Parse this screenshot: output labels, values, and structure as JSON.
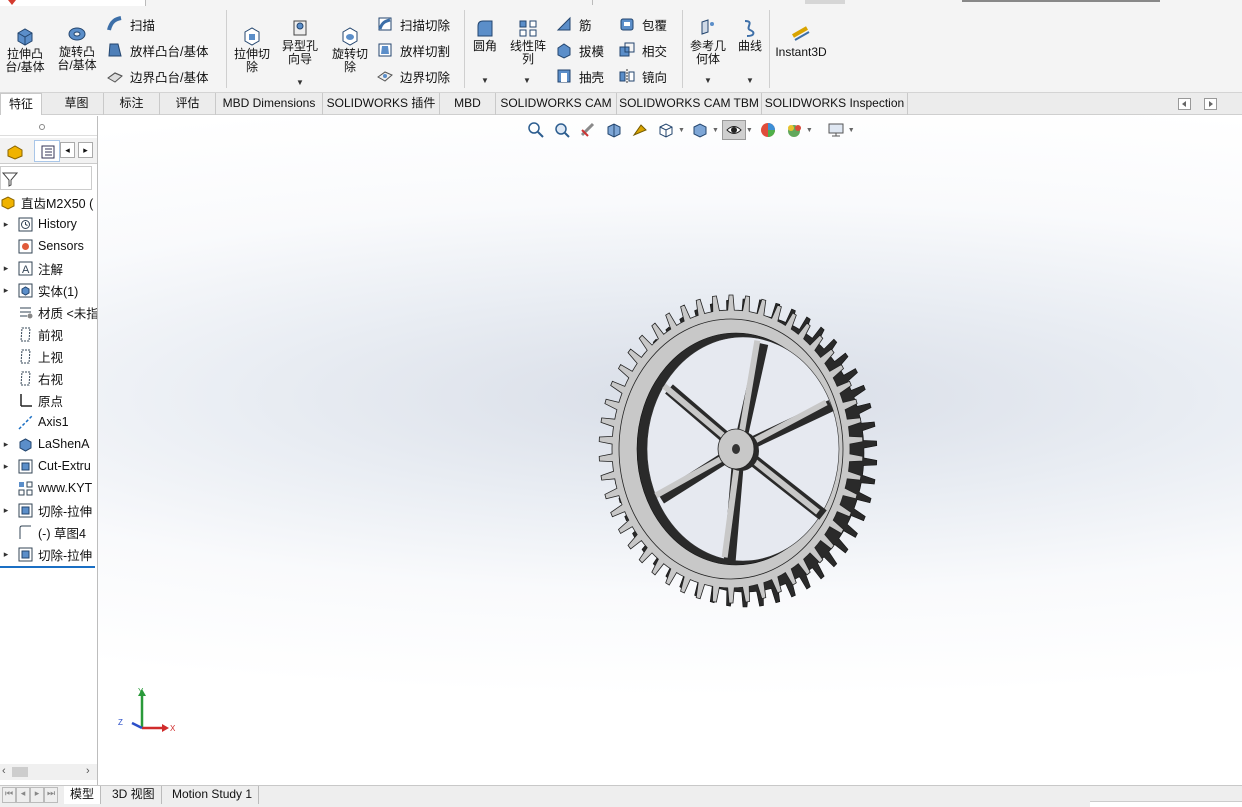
{
  "toolbar": {
    "extrude_boss": "拉伸凸\n台/基体",
    "revolve_boss": "旋转凸\n台/基体",
    "sweep": "扫描",
    "loft_boss": "放样凸台/基体",
    "boundary_boss": "边界凸台/基体",
    "extrude_cut": "拉伸切\n除",
    "hole_wizard": "异型孔\n向导",
    "revolve_cut": "旋转切\n除",
    "swept_cut": "扫描切除",
    "lofted_cut": "放样切割",
    "boundary_cut": "边界切除",
    "fillet": "圆角",
    "linear_pattern": "线性阵\n列",
    "rib": "筋",
    "draft": "拔模",
    "shell": "抽壳",
    "wrap": "包覆",
    "intersect": "相交",
    "mirror": "镜向",
    "ref_geometry": "参考几\n何体",
    "curves": "曲线",
    "instant3d": "Instant3D"
  },
  "tabs": [
    "特征",
    "草图",
    "标注",
    "评估",
    "MBD Dimensions",
    "SOLIDWORKS 插件",
    "MBD",
    "SOLIDWORKS CAM",
    "SOLIDWORKS CAM TBM",
    "SOLIDWORKS Inspection"
  ],
  "tree": {
    "root": "直齿M2X50  (",
    "items": [
      {
        "label": "History",
        "icon": "history-icon",
        "arrow": "▸"
      },
      {
        "label": "Sensors",
        "icon": "sensors-icon",
        "arrow": ""
      },
      {
        "label": "注解",
        "icon": "annotation-icon",
        "arrow": "▸"
      },
      {
        "label": "实体(1)",
        "icon": "solid-bodies-icon",
        "arrow": "▸"
      },
      {
        "label": "材质 <未指",
        "icon": "material-icon",
        "arrow": ""
      },
      {
        "label": "前视",
        "icon": "plane-icon",
        "arrow": ""
      },
      {
        "label": "上视",
        "icon": "plane-icon",
        "arrow": ""
      },
      {
        "label": "右视",
        "icon": "plane-icon",
        "arrow": ""
      },
      {
        "label": "原点",
        "icon": "origin-icon",
        "arrow": ""
      },
      {
        "label": "Axis1",
        "icon": "axis-icon",
        "arrow": ""
      },
      {
        "label": "LaShenA",
        "icon": "extrude-feature-icon",
        "arrow": "▸"
      },
      {
        "label": "Cut-Extru",
        "icon": "cut-feature-icon",
        "arrow": "▸"
      },
      {
        "label": "www.KYT",
        "icon": "pattern-feature-icon",
        "arrow": ""
      },
      {
        "label": "切除-拉伸",
        "icon": "cut-feature-icon",
        "arrow": "▸"
      },
      {
        "label": "(-) 草图4",
        "icon": "sketch-icon",
        "arrow": ""
      },
      {
        "label": "切除-拉伸",
        "icon": "cut-feature-icon",
        "arrow": "▸"
      }
    ]
  },
  "bottom_tabs": [
    "模型",
    "3D 视图",
    "Motion Study 1"
  ],
  "triad": {
    "x": "X",
    "y": "Y",
    "z": "Z"
  },
  "colors": {
    "accent": "#1a6fc4",
    "gear_face": "#c8c8c8",
    "gear_dark": "#2a2a2a"
  }
}
